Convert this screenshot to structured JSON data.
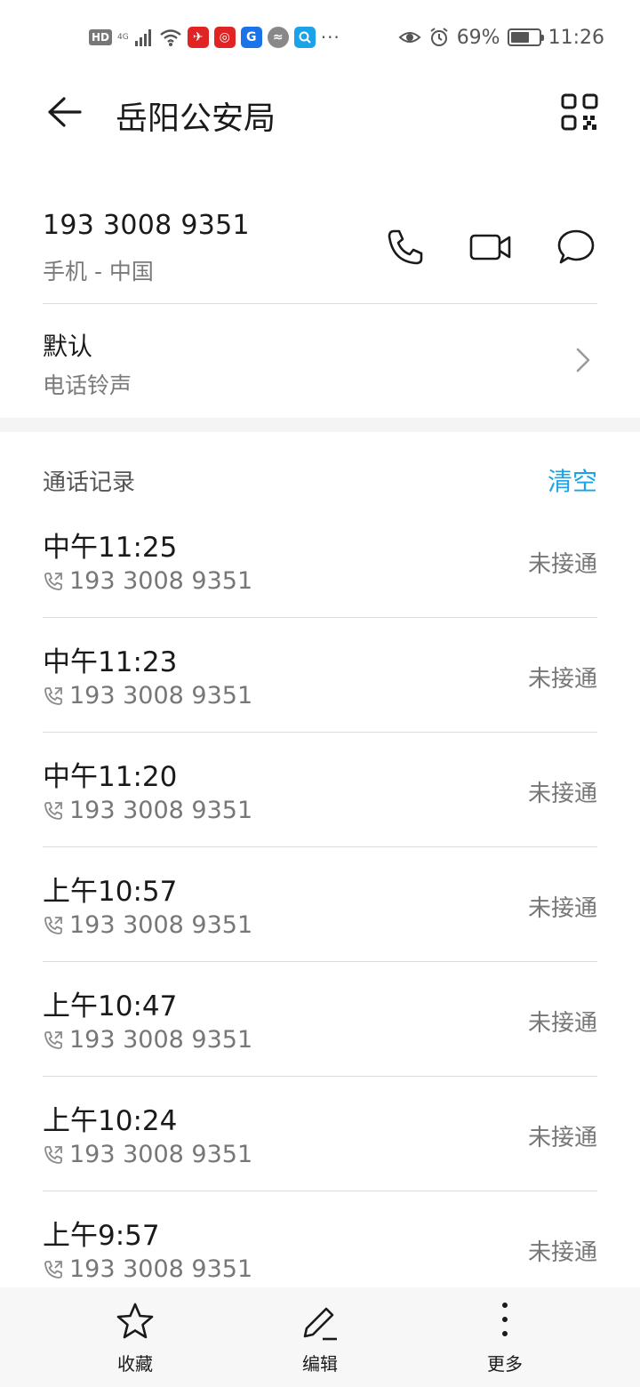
{
  "status_bar": {
    "hd": "HD",
    "network": "4G",
    "battery_text": "69%",
    "battery_level": 0.69,
    "time": "11:26",
    "app_icon_colors": [
      "#e02424",
      "#e02424",
      "#1a73e8",
      "#888888",
      "#1aa3e8"
    ],
    "overflow": "···"
  },
  "header": {
    "title": "岳阳公安局",
    "back_icon": "back-arrow-icon",
    "qr_icon": "qr-code-icon"
  },
  "contact": {
    "number": "193 3008 9351",
    "type": "手机 - 中国",
    "actions": [
      "phone-icon",
      "video-call-icon",
      "message-icon"
    ]
  },
  "ringtone": {
    "title": "默认",
    "subtitle": "电话铃声"
  },
  "call_log": {
    "title": "通话记录",
    "clear_label": "清空",
    "accent_color": "#1aa3e8",
    "entries": [
      {
        "time": "中午11:25",
        "number": "193 3008 9351",
        "status": "未接通"
      },
      {
        "time": "中午11:23",
        "number": "193 3008 9351",
        "status": "未接通"
      },
      {
        "time": "中午11:20",
        "number": "193 3008 9351",
        "status": "未接通"
      },
      {
        "time": "上午10:57",
        "number": "193 3008 9351",
        "status": "未接通"
      },
      {
        "time": "上午10:47",
        "number": "193 3008 9351",
        "status": "未接通"
      },
      {
        "time": "上午10:24",
        "number": "193 3008 9351",
        "status": "未接通"
      },
      {
        "time": "上午9:57",
        "number": "193 3008 9351",
        "status": "未接通"
      }
    ]
  },
  "bottom_bar": {
    "favorite_label": "收藏",
    "edit_label": "编辑",
    "more_label": "更多"
  }
}
